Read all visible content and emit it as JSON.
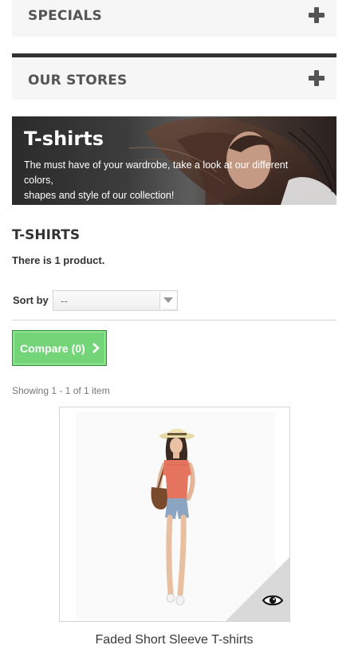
{
  "blocks": {
    "specials": "SPECIALS",
    "our_stores": "OUR STORES"
  },
  "banner": {
    "title": "T-shirts",
    "description_line1": "The must have of your wardrobe, take a look at our different colors,",
    "description_line2": "shapes and style of our collection!"
  },
  "category": {
    "title": "T-SHIRTS",
    "count_text": "There is 1 product."
  },
  "sort": {
    "label": "Sort by",
    "selected": "--"
  },
  "compare": {
    "label": "Compare (0)"
  },
  "listing": {
    "showing_text": "Showing 1 - 1 of 1 item"
  },
  "products": [
    {
      "name": "Faded Short Sleeve T-shirts"
    }
  ],
  "colors": {
    "compare_green": "#74d578",
    "block_bg": "#f6f6f6",
    "heading": "#555454"
  }
}
